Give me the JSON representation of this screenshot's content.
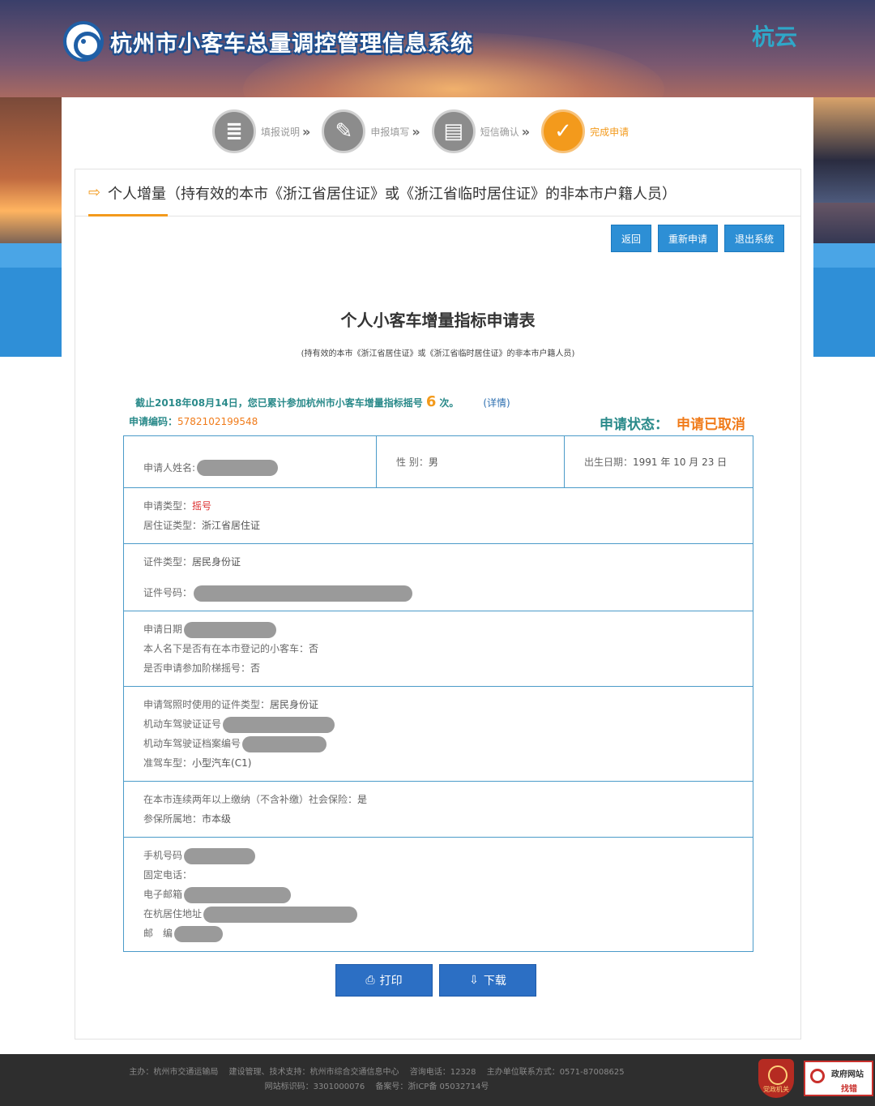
{
  "header": {
    "site_title": "杭州市小客车总量调控管理信息系统",
    "city_logo_text": "杭云"
  },
  "steps": [
    {
      "label": "填报说明",
      "icon": "document-icon",
      "active": false
    },
    {
      "label": "申报填写",
      "icon": "edit-icon",
      "active": false
    },
    {
      "label": "短信确认",
      "icon": "message-icon",
      "active": false
    },
    {
      "label": "完成申请",
      "icon": "check-icon",
      "active": true
    }
  ],
  "panel": {
    "heading": "个人增量（持有效的本市《浙江省居住证》或《浙江省临时居住证》的非本市户籍人员）",
    "buttons": {
      "back": "返回",
      "reapply": "重新申请",
      "logout": "退出系统"
    }
  },
  "form": {
    "title": "个人小客车增量指标申请表",
    "subtitle": "(持有效的本市《浙江省居住证》或《浙江省临时居住证》的非本市户籍人员)",
    "summary_prefix": "截止2018年08月14日，您已累计参加杭州市小客车增量指标摇号",
    "summary_count": "6",
    "summary_suffix": "次。",
    "detail_link": "(详情)",
    "code_label": "申请编码：",
    "code_value": "5782102199548",
    "status_label": "申请状态：",
    "status_value": "申请已取消"
  },
  "table": {
    "name_label": "申请人姓名:",
    "gender_label": "性 别：",
    "gender_value": "男",
    "birth_label": "出生日期：",
    "birth_value": "1991 年 10 月 23 日",
    "apply_type_label": "申请类型：",
    "apply_type_value": "摇号",
    "residence_type_label": "居住证类型：",
    "residence_type_value": "浙江省居住证",
    "id_type_label": "证件类型：",
    "id_type_value": "居民身份证",
    "id_no_label": "证件号码：",
    "apply_date_label": "申请日期",
    "own_car_label": "本人名下是否有在本市登记的小客车：",
    "own_car_value": "否",
    "ladder_label": "是否申请参加阶梯摇号：",
    "ladder_value": "否",
    "license_doc_label": "申请驾照时使用的证件类型：",
    "license_doc_value": "居民身份证",
    "license_no_label": "机动车驾驶证证号",
    "license_file_label": "机动车驾驶证档案编号",
    "vehicle_class_label": "准驾车型：",
    "vehicle_class_value": "小型汽车(C1)",
    "insurance_label": "在本市连续两年以上缴纳（不含补缴）社会保险：",
    "insurance_value": "是",
    "insurance_place_label": "参保所属地：",
    "insurance_place_value": "市本级",
    "mobile_label": "手机号码",
    "phone_label": "固定电话：",
    "email_label": "电子邮箱",
    "address_label": "在杭居住地址",
    "postcode_label": "邮　编"
  },
  "actions": {
    "print": "打印",
    "download": "下载"
  },
  "footer": {
    "line1": "主办：杭州市交通运输局　 建设管理、技术支持：杭州市综合交通信息中心　 咨询电话：12328　 主办单位联系方式：0571-87008625",
    "line2": "网站标识码：3301000076　 备案号：浙ICP备 05032714号",
    "badge1": "党政机关",
    "badge2_top": "政府网站",
    "badge2_bottom": "找错"
  },
  "colors": {
    "accent": "#f39a1c",
    "primary_blue": "#2d8fd5",
    "teal": "#2a8a8a",
    "status_orange": "#f07b1a",
    "table_border": "#4b9bc9"
  }
}
